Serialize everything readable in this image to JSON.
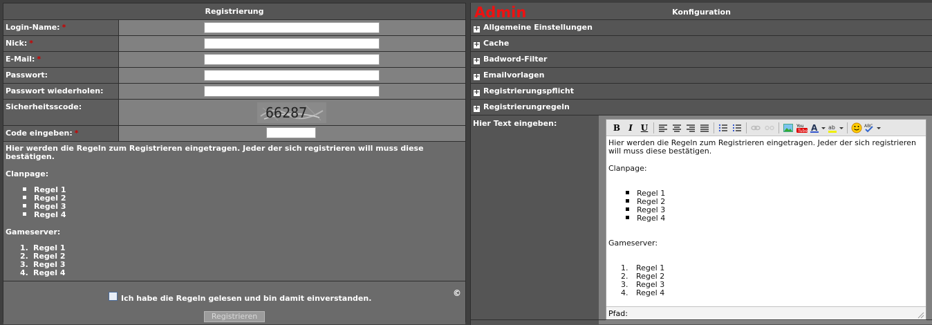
{
  "registration": {
    "title": "Registrierung",
    "fields": [
      {
        "label": "Login-Name:",
        "required": "*"
      },
      {
        "label": "Nick:",
        "required": "*"
      },
      {
        "label": "E-Mail:",
        "required": "*"
      },
      {
        "label": "Passwort:",
        "required": ""
      },
      {
        "label": "Passwort wiederholen:",
        "required": ""
      }
    ],
    "security_code_label": "Sicherheitsscode:",
    "captcha_text": "66287",
    "code_label": "Code eingeben:",
    "code_required": "*",
    "rules_intro": "Hier werden die Regeln zum Registrieren eingetragen. Jeder der sich registrieren will muss diese bestätigen.",
    "clanpage_heading": "Clanpage:",
    "clanpage_rules": [
      "Regel 1",
      "Regel 2",
      "Regel 3",
      "Regel 4"
    ],
    "gameserver_heading": "Gameserver:",
    "gameserver_rules": [
      "Regel 1",
      "Regel 2",
      "Regel 3",
      "Regel 4"
    ],
    "gameserver_numbers": [
      "1.",
      "2.",
      "3.",
      "4."
    ],
    "agree_label": "Ich habe die Regeln gelesen und bin damit einverstanden.",
    "copyright": "©",
    "submit_label": "Registrieren"
  },
  "admin": {
    "badge": "Admin",
    "title": "Konfiguration",
    "sections": [
      "Allgemeine Einstellungen",
      "Cache",
      "Badword-Filter",
      "Emailvorlagen",
      "Registrierungspflicht",
      "Registrierungregeln"
    ],
    "editor_label": "Hier Text eingeben:",
    "editor": {
      "toolbar": [
        "bold-icon",
        "italic-icon",
        "underline-icon",
        "align-left-icon",
        "align-center-icon",
        "align-right-icon",
        "justify-icon",
        "bullet-list-icon",
        "numbered-list-icon",
        "link-icon",
        "unlink-icon",
        "image-icon",
        "youtube-icon",
        "font-color-icon",
        "highlight-icon",
        "smiley-icon",
        "spellcheck-icon"
      ],
      "intro": "Hier werden die Regeln zum Registrieren eingetragen. Jeder der sich registrieren will muss diese bestätigen.",
      "clanpage_heading": "Clanpage:",
      "clanpage_rules": [
        "Regel 1",
        "Regel 2",
        "Regel 3",
        "Regel 4"
      ],
      "gameserver_heading": "Gameserver:",
      "gameserver_rules": [
        "Regel 1",
        "Regel 2",
        "Regel 3",
        "Regel 4"
      ],
      "gameserver_numbers": [
        "1.",
        "2.",
        "3.",
        "4."
      ],
      "path_label": "Pfad:"
    }
  },
  "colors": {
    "required": "#cc0000",
    "admin_badge": "#ee1111"
  }
}
